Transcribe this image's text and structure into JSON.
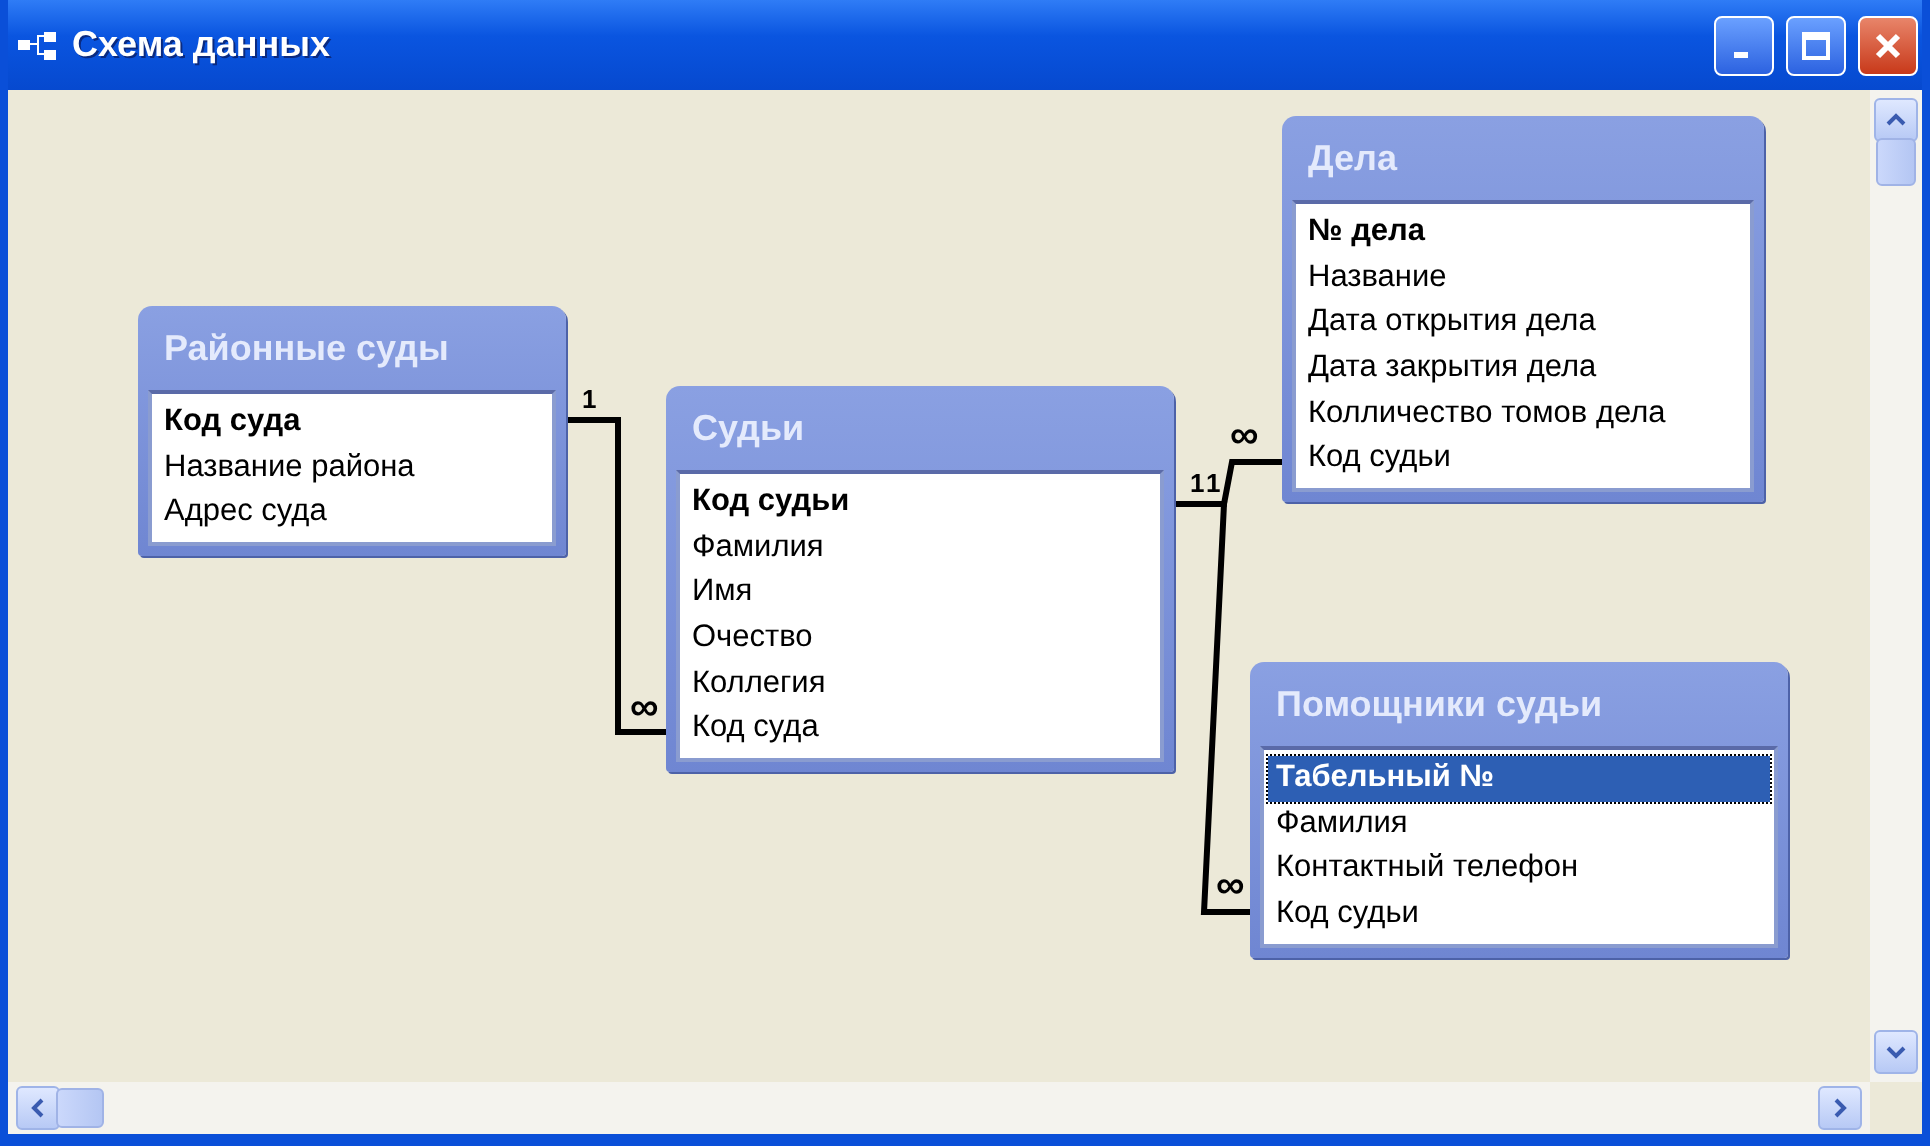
{
  "window": {
    "title": "Схема данных"
  },
  "tables": [
    {
      "name": "Районные суды",
      "fields": [
        {
          "name": "Код суда",
          "key": true,
          "selected": false
        },
        {
          "name": "Название района",
          "key": false,
          "selected": false
        },
        {
          "name": "Адрес суда",
          "key": false,
          "selected": false
        }
      ]
    },
    {
      "name": "Судьи",
      "fields": [
        {
          "name": "Код судьи",
          "key": true,
          "selected": false
        },
        {
          "name": "Фамилия",
          "key": false,
          "selected": false
        },
        {
          "name": "Имя",
          "key": false,
          "selected": false
        },
        {
          "name": "Очество",
          "key": false,
          "selected": false
        },
        {
          "name": "Коллегия",
          "key": false,
          "selected": false
        },
        {
          "name": "Код суда",
          "key": false,
          "selected": false
        }
      ]
    },
    {
      "name": "Дела",
      "fields": [
        {
          "name": "№  дела",
          "key": true,
          "selected": false
        },
        {
          "name": "Название",
          "key": false,
          "selected": false
        },
        {
          "name": "Дата открытия дела",
          "key": false,
          "selected": false
        },
        {
          "name": "Дата закрытия дела",
          "key": false,
          "selected": false
        },
        {
          "name": "Колличество томов дела",
          "key": false,
          "selected": false
        },
        {
          "name": "Код судьи",
          "key": false,
          "selected": false
        }
      ]
    },
    {
      "name": "Помощники судьи",
      "fields": [
        {
          "name": "Табельный №",
          "key": true,
          "selected": true
        },
        {
          "name": "Фамилия",
          "key": false,
          "selected": false
        },
        {
          "name": "Контактный телефон",
          "key": false,
          "selected": false
        },
        {
          "name": "Код судьи",
          "key": false,
          "selected": false
        }
      ]
    }
  ],
  "relationships": [
    {
      "one_label": "1",
      "many_label": "∞"
    },
    {
      "one_label": "1",
      "many_label": "∞"
    },
    {
      "one_label": "1",
      "many_label": "∞"
    }
  ]
}
